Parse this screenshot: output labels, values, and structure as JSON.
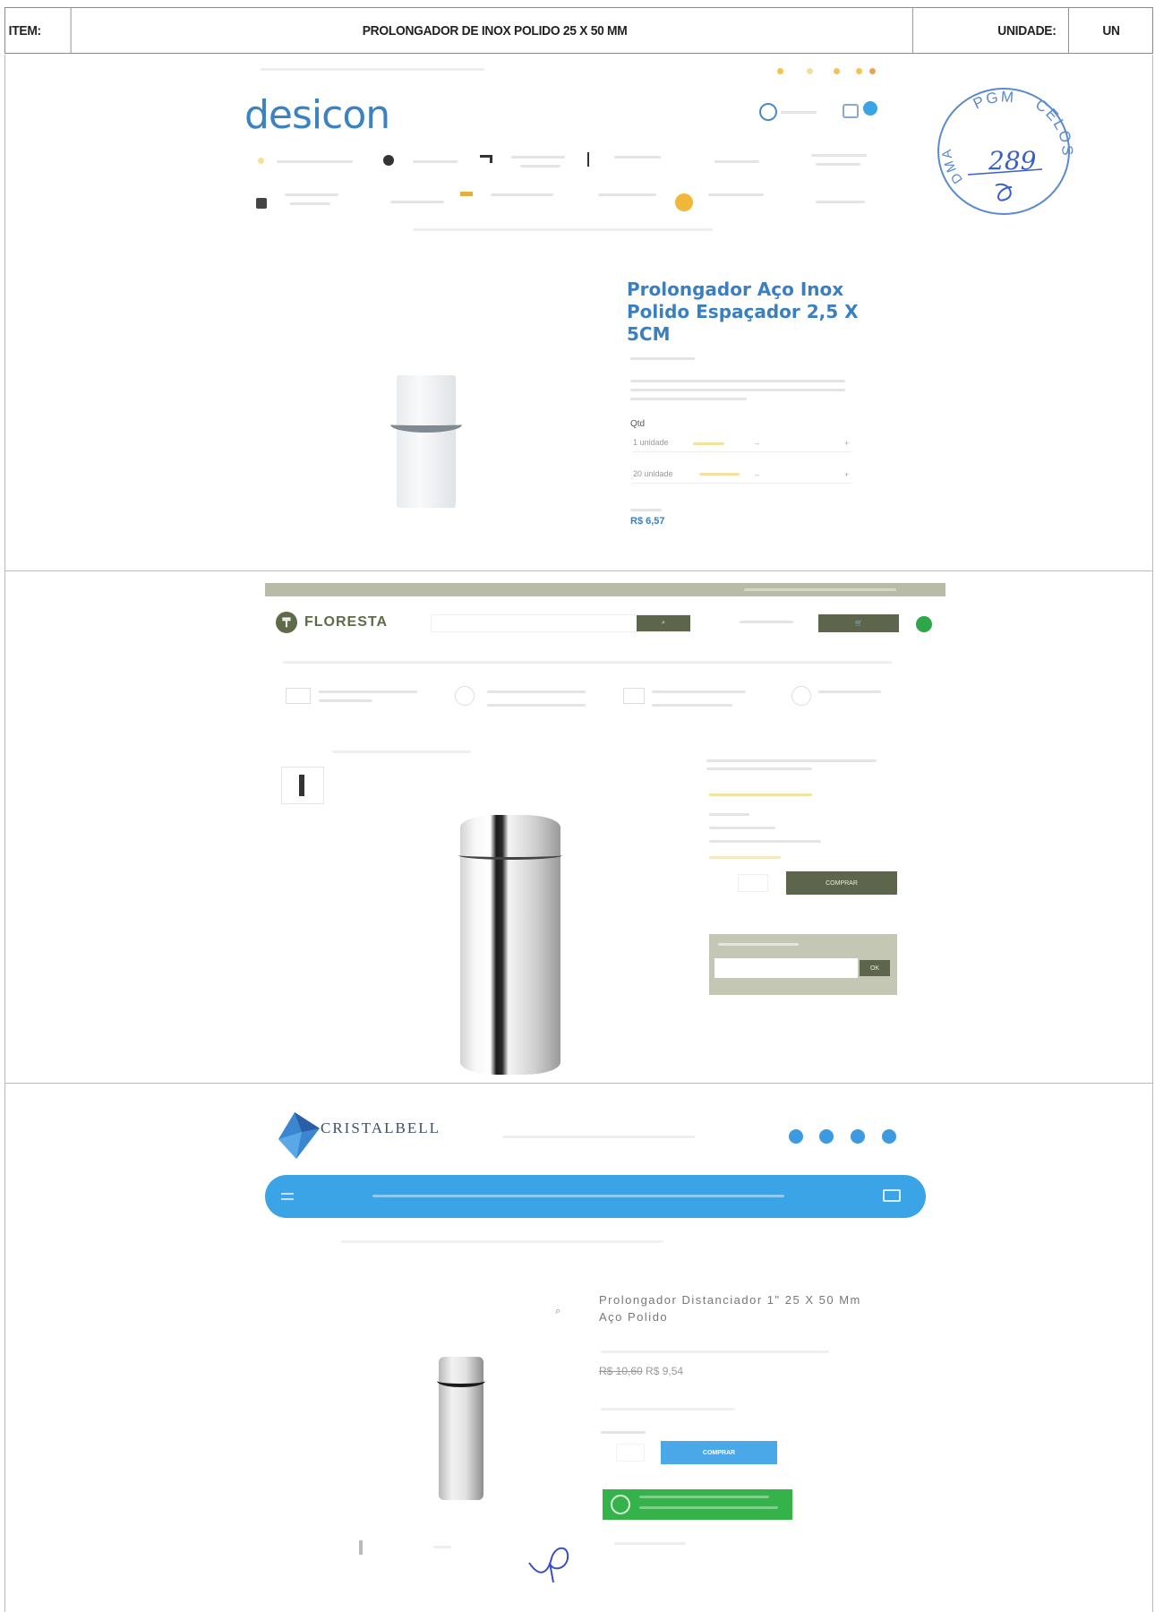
{
  "header": {
    "item_label": "ITEM:",
    "item_value": "PROLONGADOR DE INOX POLIDO 25 X 50 MM",
    "unit_label": "UNIDADE:",
    "unit_value": "UN"
  },
  "stamp": {
    "text_top": "PGM",
    "text_right": "CELOS",
    "text_left": "DMA",
    "number": "289"
  },
  "desicon": {
    "logo": "desicon",
    "product_title": "Prolongador Aço Inox Polido Espaçador 2,5 X 5CM",
    "qty_label": "Qtd",
    "rows": [
      {
        "label": "1 unidade"
      },
      {
        "label": "20 unidade"
      }
    ],
    "price": "R$ 6,57",
    "icons": [
      "user-icon",
      "cart-icon"
    ]
  },
  "floresta": {
    "logo": "FLORESTA",
    "buy_label": "COMPRAR",
    "ok_label": "OK"
  },
  "cristalbell": {
    "logo": "CRISTALBELL",
    "product_title": "Prolongador Distanciador 1\" 25 X 50 Mm Aço Polido",
    "price_old": "R$ 10,60",
    "price_new": "R$ 9,54",
    "buy_label": "COMPRAR"
  },
  "colors": {
    "desicon_blue": "#3a82c4",
    "floresta_green": "#5d664d",
    "cristal_blue": "#3aa4e6",
    "whatsapp_green": "#35b24a"
  }
}
